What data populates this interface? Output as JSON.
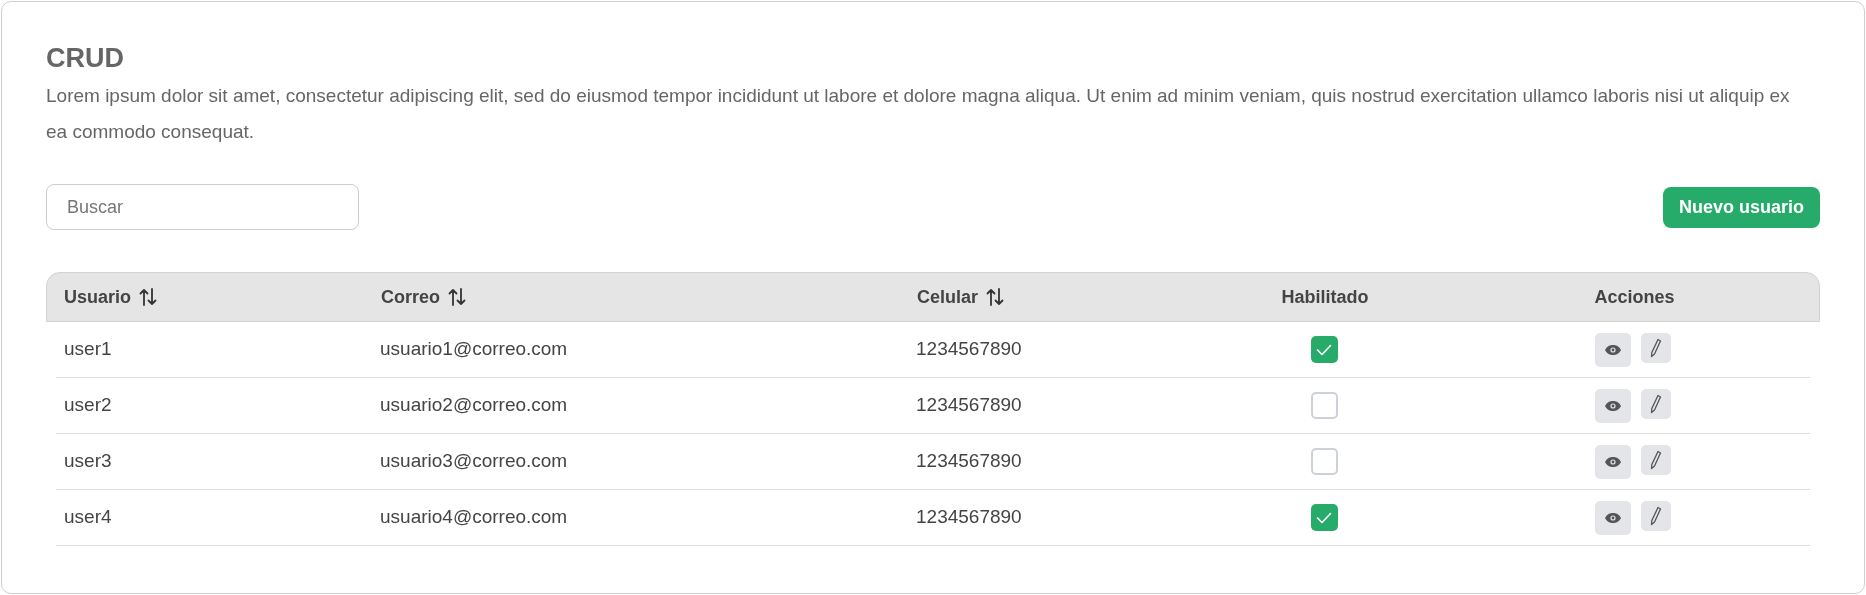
{
  "title": "CRUD",
  "description": "Lorem ipsum dolor sit amet, consectetur adipiscing elit, sed do eiusmod tempor incididunt ut labore et dolore magna aliqua. Ut enim ad minim veniam, quis nostrud exercitation ullamco laboris nisi ut aliquip ex ea commodo consequat.",
  "search": {
    "placeholder": "Buscar"
  },
  "new_button": "Nuevo usuario",
  "table": {
    "columns": [
      {
        "label": "Usuario",
        "kind": "sortable"
      },
      {
        "label": "Correo",
        "kind": "sortable"
      },
      {
        "label": "Celular",
        "kind": "sortable"
      },
      {
        "label": "Habilitado",
        "kind": "center"
      },
      {
        "label": "Acciones",
        "kind": "center"
      }
    ],
    "rows": [
      {
        "user": "user1",
        "email": "usuario1@correo.com",
        "phone": "1234567890",
        "enabled": true
      },
      {
        "user": "user2",
        "email": "usuario2@correo.com",
        "phone": "1234567890",
        "enabled": false
      },
      {
        "user": "user3",
        "email": "usuario3@correo.com",
        "phone": "1234567890",
        "enabled": false
      },
      {
        "user": "user4",
        "email": "usuario4@correo.com",
        "phone": "1234567890",
        "enabled": true
      }
    ]
  }
}
